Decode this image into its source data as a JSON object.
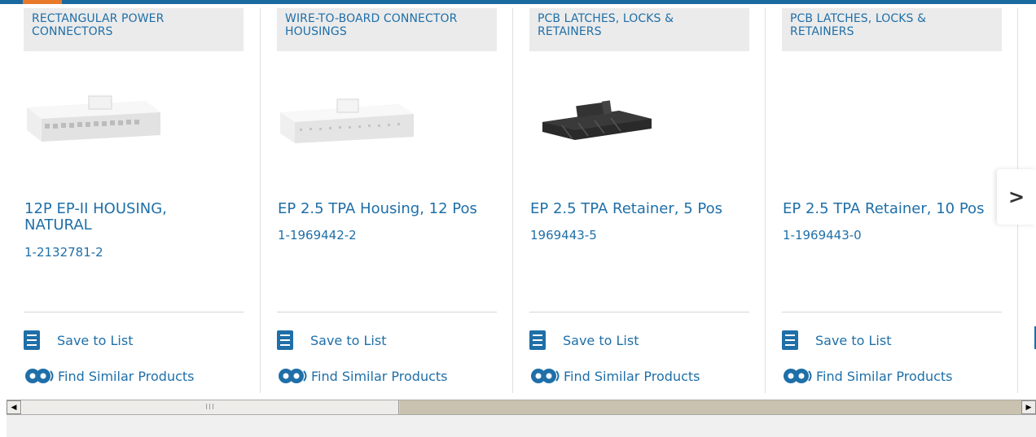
{
  "products": [
    {
      "category": "RECTANGULAR POWER CONNECTORS",
      "title": "12P EP-II HOUSING, NATURAL",
      "part_number": "1-2132781-2",
      "image": "white-connector-housing",
      "save_label": "Save to List",
      "find_label": "Find Similar Products"
    },
    {
      "category": "WIRE-TO-BOARD CONNECTOR HOUSINGS",
      "title": "EP 2.5 TPA Housing, 12 Pos",
      "part_number": "1-1969442-2",
      "image": "white-connector-housing",
      "save_label": "Save to List",
      "find_label": "Find Similar Products"
    },
    {
      "category": "PCB LATCHES, LOCKS & RETAINERS",
      "title": "EP 2.5 TPA Retainer, 5 Pos",
      "part_number": "1969443-5",
      "image": "black-retainer",
      "save_label": "Save to List",
      "find_label": "Find Similar Products"
    },
    {
      "category": "PCB LATCHES, LOCKS & RETAINERS",
      "title": "EP 2.5 TPA Retainer, 10 Pos",
      "part_number": "1-1969443-0",
      "image": "none",
      "save_label": "Save to List",
      "find_label": "Find Similar Products"
    }
  ],
  "carousel": {
    "next_icon": "chevron-right-icon",
    "next_glyph": ">"
  },
  "scrollbar": {
    "left_glyph": "◀",
    "right_glyph": "▶",
    "thumb_grip": "III"
  },
  "colors": {
    "accent": "#1f6fa8",
    "top_bar": "#1a6aa0",
    "top_bar_accent": "#e8792b"
  }
}
